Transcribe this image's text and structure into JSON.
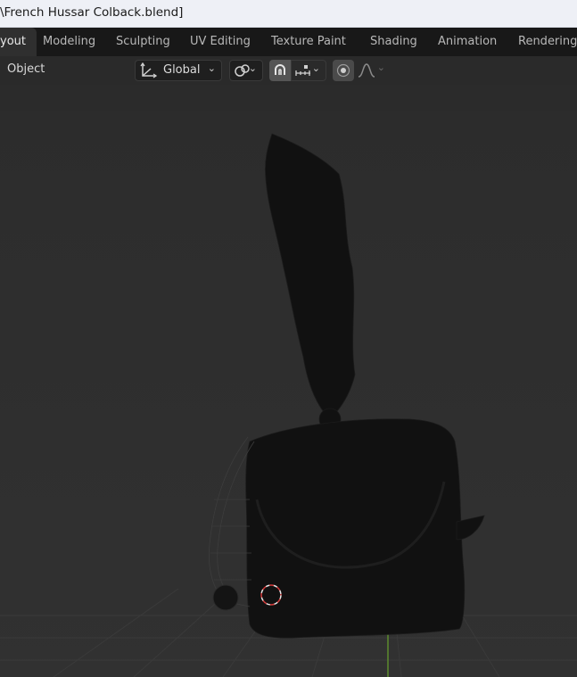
{
  "window": {
    "title": "\\French Hussar Colback.blend]"
  },
  "workspace_tabs": [
    {
      "label": "yout",
      "active": true
    },
    {
      "label": "Modeling"
    },
    {
      "label": "Sculpting"
    },
    {
      "label": "UV Editing"
    },
    {
      "label": "Texture Paint"
    },
    {
      "label": "Shading"
    },
    {
      "label": "Animation"
    },
    {
      "label": "Rendering"
    }
  ],
  "header": {
    "menu_object": "Object",
    "transform_orientation": {
      "icon": "transform-orientation-icon",
      "value": "Global"
    },
    "pivot_icon": "pivot-point-icon",
    "snap_icon": "snap-magnet-icon",
    "snap_target_icon": "snap-increment-icon",
    "proportional_icon": "proportional-editing-icon",
    "falloff_icon": "falloff-curve-icon"
  },
  "colors": {
    "titlebar": "#eef0f6",
    "tabbar": "#181818",
    "header": "#2a2a2a",
    "viewport": "#303030",
    "mesh": "#0d0d0d",
    "cursor_red": "#d33a3a",
    "axis_green": "#5c8a2e"
  }
}
